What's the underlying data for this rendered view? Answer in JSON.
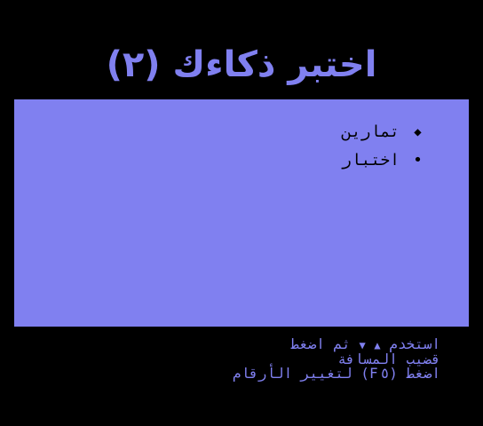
{
  "title": "اختبر ذكاءك (٢)",
  "menu": {
    "items": [
      {
        "label": "تمارين",
        "marker": "◆"
      },
      {
        "label": "اختبار",
        "marker": "•"
      }
    ]
  },
  "instructions": {
    "line1_prefix": "استخدم",
    "up_arrow": "▲",
    "down_arrow": "▼",
    "line1_suffix": "ثم اضغط",
    "line2": "قضيب المسافة",
    "line3": "اضغط (F٥) لتغيير الأرقام"
  },
  "colors": {
    "background": "#000000",
    "panel": "#8080f0",
    "text_dark": "#000000",
    "text_light": "#8080f0"
  }
}
